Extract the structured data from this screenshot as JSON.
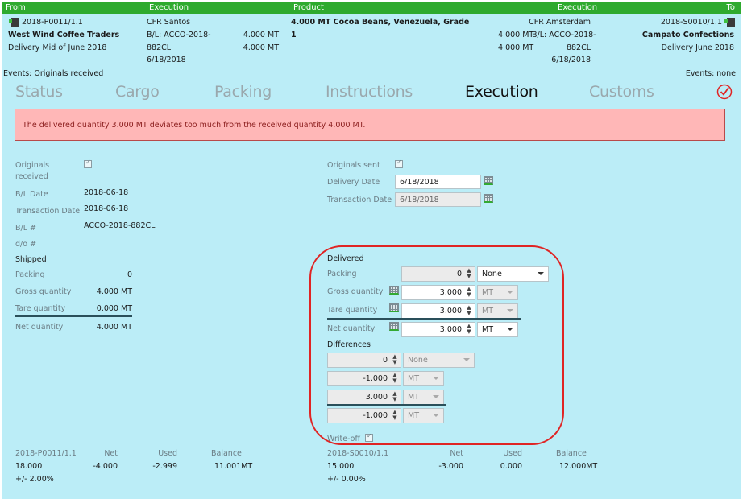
{
  "header": {
    "cols": {
      "from": "From",
      "execution_left": "Execution",
      "product": "Product",
      "execution_right": "Execution",
      "to": "To"
    },
    "from": {
      "contract": "2018-P0011/1.1",
      "party": "West Wind Coffee Traders",
      "delivery": "Delivery Mid of June 2018",
      "events": "Events: Originals received"
    },
    "exec_left": {
      "incoterm": "CFR Santos",
      "bl_line1": "B/L: ACCO-2018-",
      "bl_line2": "882CL",
      "date": "6/18/2018",
      "qty1": "4.000 MT",
      "qty2": "4.000 MT"
    },
    "product": {
      "line1": "4.000 MT Cocoa Beans, Venezuela, Grade",
      "line2": "1"
    },
    "exec_right": {
      "incoterm": "CFR Amsterdam",
      "qty1": "4.000 MT",
      "bl_line1": "B/L: ACCO-2018-",
      "qty2": "4.000 MT",
      "bl_line2": "882CL",
      "date": "6/18/2018"
    },
    "to": {
      "contract": "2018-S0010/1.1",
      "party": "Campato Confections",
      "delivery": "Delivery June 2018",
      "events": "Events: none"
    }
  },
  "tabs": [
    {
      "label": "Status",
      "active": false
    },
    {
      "label": "Cargo",
      "active": false
    },
    {
      "label": "Packing",
      "active": false
    },
    {
      "label": "Instructions",
      "active": false
    },
    {
      "label": "Execution",
      "active": true
    },
    {
      "label": "Customs",
      "active": false
    }
  ],
  "alert": {
    "message": "The delivered quantity 3.000 MT deviates too much from the received quantity 4.000 MT.",
    "color": "#ffb7b7"
  },
  "left": {
    "originals_received_label_1": "Originals",
    "originals_received_label_2": "received",
    "originals_received": true,
    "bl_date_label": "B/L Date",
    "bl_date": "2018-06-18",
    "transaction_date_label": "Transaction Date",
    "transaction_date": "2018-06-18",
    "bl_no_label": "B/L #",
    "bl_no": "ACCO-2018-882CL",
    "do_no_label": "d/o #",
    "shipped_heading": "Shipped",
    "packing_label": "Packing",
    "packing": "0",
    "gross_label": "Gross quantity",
    "gross": "4.000 MT",
    "tare_label": "Tare quantity",
    "tare": "0.000 MT",
    "net_label": "Net quantity",
    "net": "4.000 MT"
  },
  "right": {
    "originals_sent_label": "Originals sent",
    "originals_sent": true,
    "delivery_date_label": "Delivery Date",
    "delivery_date": "6/18/2018",
    "transaction_date_label": "Transaction Date",
    "transaction_date": "6/18/2018",
    "delivered_heading": "Delivered",
    "packing_label": "Packing",
    "packing": "0",
    "packing_unit": "None",
    "gross_label": "Gross quantity",
    "gross": "3.000",
    "gross_unit": "MT",
    "tare_label": "Tare quantity",
    "tare": "3.000",
    "tare_unit": "MT",
    "net_label": "Net quantity",
    "net": "3.000",
    "net_unit": "MT",
    "differences_heading": "Differences",
    "diff_packing": "0",
    "diff_packing_unit": "None",
    "diff_gross": "-1.000",
    "diff_gross_unit": "MT",
    "diff_tare": "3.000",
    "diff_tare_unit": "MT",
    "diff_net": "-1.000",
    "diff_net_unit": "MT",
    "writeoff_label": "Write-off",
    "writeoff": true
  },
  "summary_left": {
    "contract": "2018-P0011/1.1",
    "net_label": "Net",
    "used_label": "Used",
    "balance_label": "Balance",
    "total": "18.000",
    "net": "-4.000",
    "used": "-2.999",
    "balance": "11.001MT",
    "tolerance": "+/- 2.00%"
  },
  "summary_right": {
    "contract": "2018-S0010/1.1",
    "net_label": "Net",
    "used_label": "Used",
    "balance_label": "Balance",
    "total": "15.000",
    "net": "-3.000",
    "used": "0.000",
    "balance": "12.000MT",
    "tolerance": "+/- 0.00%"
  },
  "colors": {
    "topbar": "#2eaa2e",
    "background": "#bbedf7",
    "highlight": "#e02424"
  }
}
